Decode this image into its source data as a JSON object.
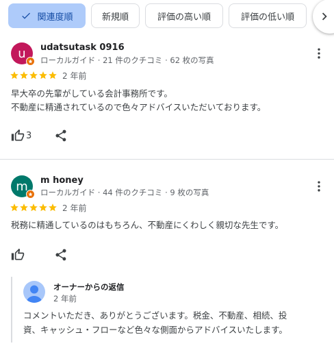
{
  "sort_chips": {
    "items": [
      {
        "label": "関連度順",
        "selected": true
      },
      {
        "label": "新規順",
        "selected": false
      },
      {
        "label": "評価の高い順",
        "selected": false
      },
      {
        "label": "評価の低い順",
        "selected": false
      }
    ],
    "scroll_icon": "chevron-right-icon"
  },
  "reviews": [
    {
      "avatar_letter": "u",
      "avatar_color": "#c2185b",
      "name": "udatsutask 0916",
      "meta": "ローカルガイド · 21 件のクチコミ · 62 枚の写真",
      "rating": 5,
      "date": "2 年前",
      "text_lines": [
        "早大卒の先輩がしている会計事務所です。",
        "不動産に精通されているので色々アドバイスいただいております。"
      ],
      "likes": "3"
    },
    {
      "avatar_letter": "m",
      "avatar_color": "#00796b",
      "name": "m honey",
      "meta": "ローカルガイド · 44 件のクチコミ · 9 枚の写真",
      "rating": 5,
      "date": "2 年前",
      "text_lines": [
        "税務に精通しているのはもちろん、不動産にくわしく親切な先生です。"
      ],
      "likes": ""
    }
  ],
  "owner_reply": {
    "label": "オーナーからの返信",
    "date": "2 年前",
    "text_lines": [
      "コメントいただき、ありがとうございます。税金、不動産、相続、投",
      "資、キャッシュ・フローなど色々な側面からアドバイスいたします。"
    ]
  },
  "colors": {
    "star": "#fbbc04",
    "selected_chip_bg": "#aecbfa",
    "local_guide_badge": "#e8710a"
  }
}
